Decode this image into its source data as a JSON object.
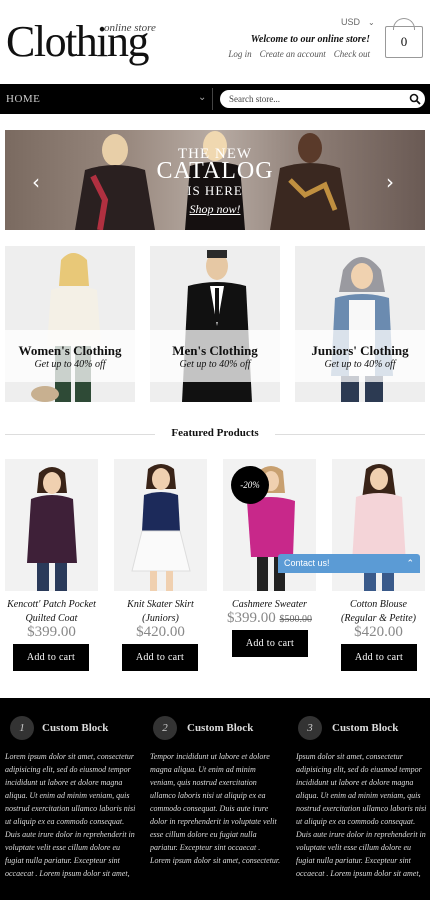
{
  "header": {
    "logo": "Clothing",
    "logo_sub": "online store",
    "currency": "USD",
    "welcome": "Welcome to our online store!",
    "links": [
      "Log in",
      "Create an account",
      "Check out"
    ],
    "cart_count": "0"
  },
  "nav": {
    "home": "HOME",
    "search_placeholder": "Search store..."
  },
  "banner": {
    "line1": "THE NEW",
    "line2": "CATALOG",
    "line3": "IS HERE",
    "link": "Shop now!"
  },
  "categories": [
    {
      "title": "Women's Clothing",
      "sub": "Get up to 40% off"
    },
    {
      "title": "Men's Clothing",
      "sub": "Get up to 40% off"
    },
    {
      "title": "Juniors' Clothing",
      "sub": "Get up to 40% off"
    }
  ],
  "featured": {
    "title": "Featured Products",
    "sale_badge": "-20%",
    "contact": "Contact us!",
    "products": [
      {
        "name_l1": "Kencott' Patch Pocket",
        "name_l2": "Quilted Coat",
        "price": "$399.00",
        "old": "",
        "btn": "Add to cart"
      },
      {
        "name_l1": "Knit Skater Skirt",
        "name_l2": "(Juniors)",
        "price": "$420.00",
        "old": "",
        "btn": "Add to cart"
      },
      {
        "name_l1": "Cashmere Sweater",
        "name_l2": "",
        "price": "$399.00",
        "old": "$500.00",
        "btn": "Add to cart"
      },
      {
        "name_l1": "Cotton Blouse",
        "name_l2": "(Regular & Petite)",
        "price": "$420.00",
        "old": "",
        "btn": "Add to cart"
      }
    ]
  },
  "footer": {
    "blocks": [
      {
        "num": "1",
        "title": "Custom Block",
        "text": "Lorem ipsum dolor sit amet, consectetur adipisicing elit, sed do eiusmod tempor incididunt ut labore et dolore magna aliqua. Ut enim ad minim veniam, quis nostrud exercitation ullamco laboris nisi ut aliquip ex ea commodo consequat. Duis aute irure dolor in reprehenderit in voluptate velit esse cillum dolore eu fugiat nulla pariatur. Excepteur sint occaecat . Lorem ipsum dolor sit amet,"
      },
      {
        "num": "2",
        "title": "Custom Block",
        "text": "Tempor incididunt ut labore et dolore magna aliqua. Ut enim ad minim veniam, quis nostrud exercitation ullamco laboris nisi ut aliquip ex ea commodo consequat. Duis aute irure dolor in reprehenderit in voluptate velit esse cillum dolore eu fugiat nulla pariatur. Excepteur sint occaecat . Lorem ipsum dolor sit amet, consectetur."
      },
      {
        "num": "3",
        "title": "Custom Block",
        "text": "Ipsum dolor sit amet, consectetur adipisicing elit, sed do eiusmod tempor incididunt ut labore et dolore magna aliqua. Ut enim ad minim veniam, quis nostrud exercitation ullamco laboris nisi ut aliquip ex ea commodo consequat. Duis aute irure dolor in reprehenderit in voluptate velit esse cillum dolore eu fugiat nulla pariatur. Excepteur sint occaecat . Lorem ipsum dolor sit amet,"
      }
    ]
  }
}
